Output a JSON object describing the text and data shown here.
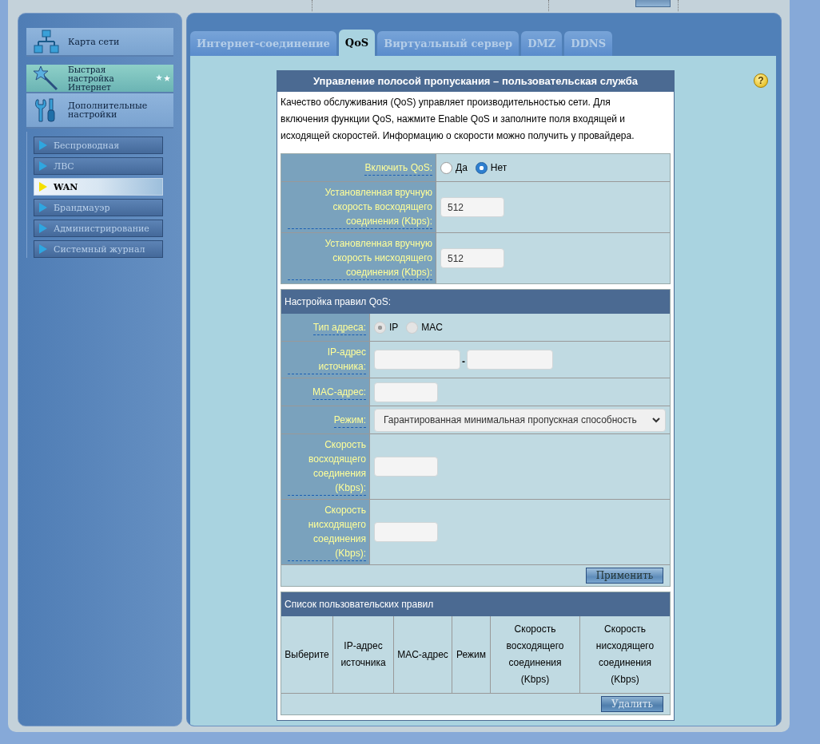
{
  "sidebar": {
    "main_items": [
      {
        "label": "Карта сети",
        "selected": false
      },
      {
        "label": "Быстрая настройка Интернет",
        "selected": true
      },
      {
        "label": "Дополнительные настройки",
        "selected": false
      }
    ],
    "sub_items": [
      {
        "label": "Беспроводная",
        "selected": false
      },
      {
        "label": "ЛВС",
        "selected": false
      },
      {
        "label": "WAN",
        "selected": true
      },
      {
        "label": "Брандмауэр",
        "selected": false
      },
      {
        "label": "Администрирование",
        "selected": false
      },
      {
        "label": "Системный журнал",
        "selected": false
      }
    ]
  },
  "tabs": [
    {
      "label": "Интернет-соединение",
      "selected": false
    },
    {
      "label": "QoS",
      "selected": true
    },
    {
      "label": "Виртуальный сервер",
      "selected": false
    },
    {
      "label": "DMZ",
      "selected": false
    },
    {
      "label": "DDNS",
      "selected": false
    }
  ],
  "help": {
    "symbol": "?"
  },
  "panel": {
    "title": "Управление полосой пропускания – пользовательская служба",
    "description": "Качество обслуживания (QoS) управляет производительностью сети. Для включения функции QoS, нажмите Enable QoS и заполните поля входящей и исходящей скоростей. Информацию о скорости можно получить у провайдера.",
    "general_rows": [
      {
        "kind": "radio",
        "label": "Включить QoS:",
        "options": [
          {
            "label": "Да",
            "selected": false
          },
          {
            "label": "Нет",
            "selected": true
          }
        ]
      },
      {
        "kind": "text",
        "label": "Установленная вручную скорость восходящего соединения (Kbps):",
        "value": "512"
      },
      {
        "kind": "text",
        "label": "Установленная вручную скорость нисходящего соединения (Kbps):",
        "value": "512"
      }
    ],
    "rules_title": "Настройка правил QoS:",
    "rule_rows": [
      {
        "kind": "radio",
        "label": "Тип адреса:",
        "disabled": true,
        "options": [
          {
            "label": "IP",
            "selected": true
          },
          {
            "label": "MAC",
            "selected": false
          }
        ]
      },
      {
        "kind": "range",
        "label": "IP-адрес источника:",
        "separator": "-"
      },
      {
        "kind": "text",
        "label": "MAC-адрес:"
      },
      {
        "kind": "select",
        "label": "Режим:",
        "value": "Гарантированная минимальная пропускная способность"
      },
      {
        "kind": "number",
        "label": "Скорость восходящего соединения (Kbps):"
      },
      {
        "kind": "number",
        "label": "Скорость нисходящего соединения (Kbps):"
      }
    ],
    "apply_button": {
      "label": "Применить",
      "disabled": false
    },
    "list_title": "Список пользовательских правил",
    "list_columns": [
      "Выберите",
      "IP-адрес источника",
      "MAC-адрес",
      "Режим",
      "Скорость восходящего соединения (Kbps)",
      "Скорость нисходящего соединения (Kbps)"
    ],
    "delete_button": {
      "label": "Удалить",
      "disabled": true
    }
  }
}
